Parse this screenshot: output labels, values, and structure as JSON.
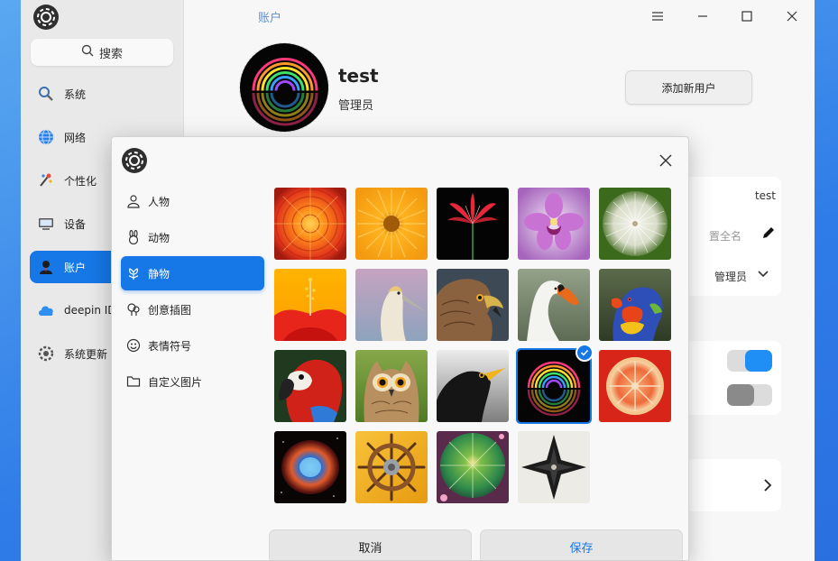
{
  "sidebar": {
    "search_label": "搜索",
    "items": [
      {
        "label": "系统",
        "icon": "system-icon"
      },
      {
        "label": "网络",
        "icon": "network-icon"
      },
      {
        "label": "个性化",
        "icon": "personalization-icon"
      },
      {
        "label": "设备",
        "icon": "device-icon"
      },
      {
        "label": "账户",
        "icon": "account-icon",
        "active": true
      },
      {
        "label": "deepin ID",
        "icon": "cloud-icon"
      },
      {
        "label": "系统更新",
        "icon": "update-icon"
      }
    ]
  },
  "header": {
    "breadcrumb": "账户"
  },
  "account": {
    "name": "test",
    "role": "管理员",
    "add_user_label": "添加新用户",
    "detail_value": "test",
    "fullname_placeholder": "置全名",
    "account_type": "管理员"
  },
  "dialog": {
    "categories": [
      {
        "label": "人物",
        "icon": "person-icon"
      },
      {
        "label": "动物",
        "icon": "rabbit-icon"
      },
      {
        "label": "静物",
        "icon": "flower-icon",
        "active": true
      },
      {
        "label": "创意插图",
        "icon": "tree-icon"
      },
      {
        "label": "表情符号",
        "icon": "smiley-icon"
      },
      {
        "label": "自定义图片",
        "icon": "folder-icon"
      }
    ],
    "images": [
      {
        "name": "red-dahlia"
      },
      {
        "name": "orange-flower"
      },
      {
        "name": "red-lily"
      },
      {
        "name": "purple-orchid"
      },
      {
        "name": "dandelion"
      },
      {
        "name": "hibiscus"
      },
      {
        "name": "gannet-bird"
      },
      {
        "name": "hawk"
      },
      {
        "name": "swan"
      },
      {
        "name": "lorikeet"
      },
      {
        "name": "parrot"
      },
      {
        "name": "owl"
      },
      {
        "name": "blackbird"
      },
      {
        "name": "neon-rainbow",
        "selected": true
      },
      {
        "name": "blood-orange"
      },
      {
        "name": "helix-nebula"
      },
      {
        "name": "ship-wheel"
      },
      {
        "name": "cactus"
      },
      {
        "name": "geometric-star"
      }
    ],
    "cancel_label": "取消",
    "save_label": "保存"
  },
  "colors": {
    "accent": "#1677e6",
    "sidebar_bg": "#e9e9e9",
    "window_bg": "#f7f7f7"
  }
}
